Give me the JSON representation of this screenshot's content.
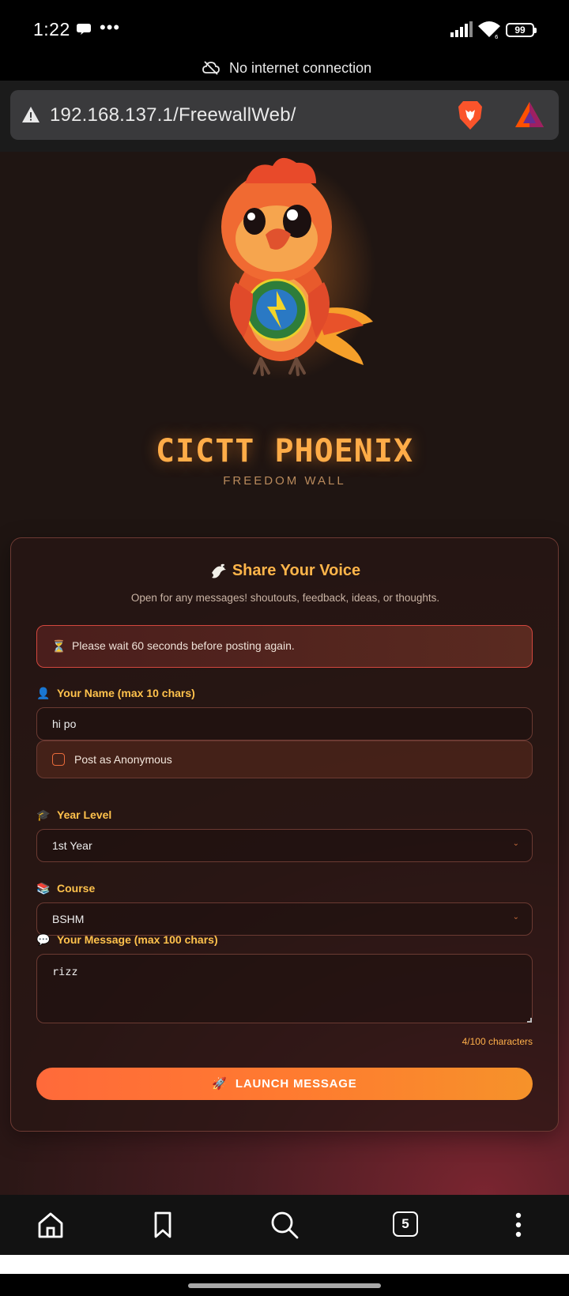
{
  "status_bar": {
    "time": "1:22",
    "battery": "99",
    "more": "•••"
  },
  "offline_banner": {
    "text": "No internet connection"
  },
  "browser": {
    "url": "192.168.137.1/FreewallWeb/"
  },
  "brand": {
    "title": "CICTT PHOENIX",
    "subtitle": "FREEDOM WALL"
  },
  "form": {
    "title": "Share Your Voice",
    "subtitle": "Open for any messages! shoutouts, feedback, ideas, or thoughts.",
    "alert": {
      "icon": "⏳",
      "text": "Please wait 60 seconds before posting again."
    },
    "name": {
      "icon": "👤",
      "label": "Your Name (max 10 chars)",
      "value": "hi po"
    },
    "anonymous": {
      "label": "Post as Anonymous",
      "checked": false
    },
    "year": {
      "icon": "🎓",
      "label": "Year Level",
      "value": "1st Year"
    },
    "course": {
      "icon": "📚",
      "label": "Course",
      "value": "BSHM"
    },
    "message": {
      "icon": "💬",
      "label": "Your Message (max 100 chars)",
      "value": "rizz",
      "counter": "4/100 characters"
    },
    "submit": {
      "icon": "🚀",
      "label": "LAUNCH MESSAGE"
    }
  },
  "bottom_nav": {
    "tab_count": "5"
  },
  "colors": {
    "accent": "#ffac48",
    "button_start": "#ff6a3a",
    "button_end": "#f6922a",
    "alert_border": "#d2473e"
  }
}
